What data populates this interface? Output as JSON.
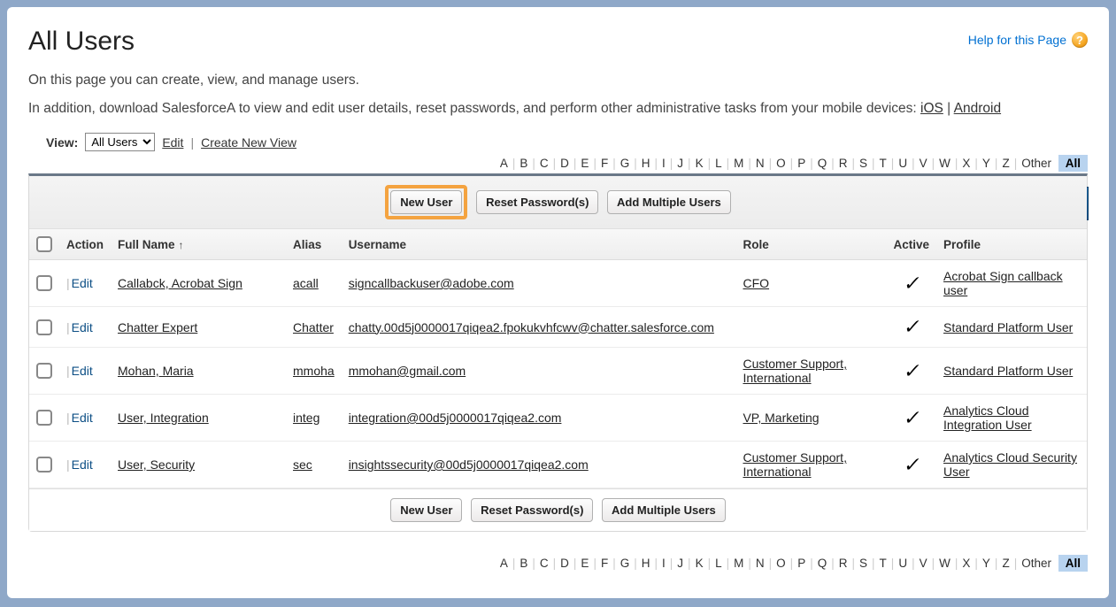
{
  "page": {
    "title": "All Users",
    "help_link": "Help for this Page",
    "desc1": "On this page you can create, view, and manage users.",
    "desc2_prefix": "In addition, download SalesforceA to view and edit user details, reset passwords, and perform other administrative tasks from your mobile devices: ",
    "ios_link": "iOS",
    "android_link": "Android"
  },
  "view": {
    "label": "View:",
    "selected": "All Users",
    "edit": "Edit",
    "create": "Create New View"
  },
  "alpha": {
    "letters": [
      "A",
      "B",
      "C",
      "D",
      "E",
      "F",
      "G",
      "H",
      "I",
      "J",
      "K",
      "L",
      "M",
      "N",
      "O",
      "P",
      "Q",
      "R",
      "S",
      "T",
      "U",
      "V",
      "W",
      "X",
      "Y",
      "Z"
    ],
    "other": "Other",
    "all": "All"
  },
  "buttons": {
    "new_user": "New User",
    "reset_passwords": "Reset Password(s)",
    "add_multiple": "Add Multiple Users"
  },
  "columns": {
    "action": "Action",
    "full_name": "Full Name",
    "alias": "Alias",
    "username": "Username",
    "role": "Role",
    "active": "Active",
    "profile": "Profile"
  },
  "action_label": "Edit",
  "rows": [
    {
      "full_name": "Callabck, Acrobat Sign",
      "alias": "acall",
      "username": "signcallbackuser@adobe.com",
      "role": "CFO",
      "active": true,
      "profile": "Acrobat Sign callback user"
    },
    {
      "full_name": "Chatter Expert",
      "alias": "Chatter",
      "username": "chatty.00d5j0000017qiqea2.fpokukvhfcwv@chatter.salesforce.com",
      "role": "",
      "active": true,
      "profile": "Standard Platform User"
    },
    {
      "full_name": "Mohan, Maria",
      "alias": "mmoha",
      "username": "mmohan@gmail.com",
      "role": "Customer Support, International",
      "active": true,
      "profile": "Standard Platform User"
    },
    {
      "full_name": "User, Integration",
      "alias": "integ",
      "username": "integration@00d5j0000017qiqea2.com",
      "role": "VP, Marketing",
      "active": true,
      "profile": "Analytics Cloud Integration User"
    },
    {
      "full_name": "User, Security",
      "alias": "sec",
      "username": "insightssecurity@00d5j0000017qiqea2.com",
      "role": "Customer Support, International",
      "active": true,
      "profile": "Analytics Cloud Security User"
    }
  ]
}
